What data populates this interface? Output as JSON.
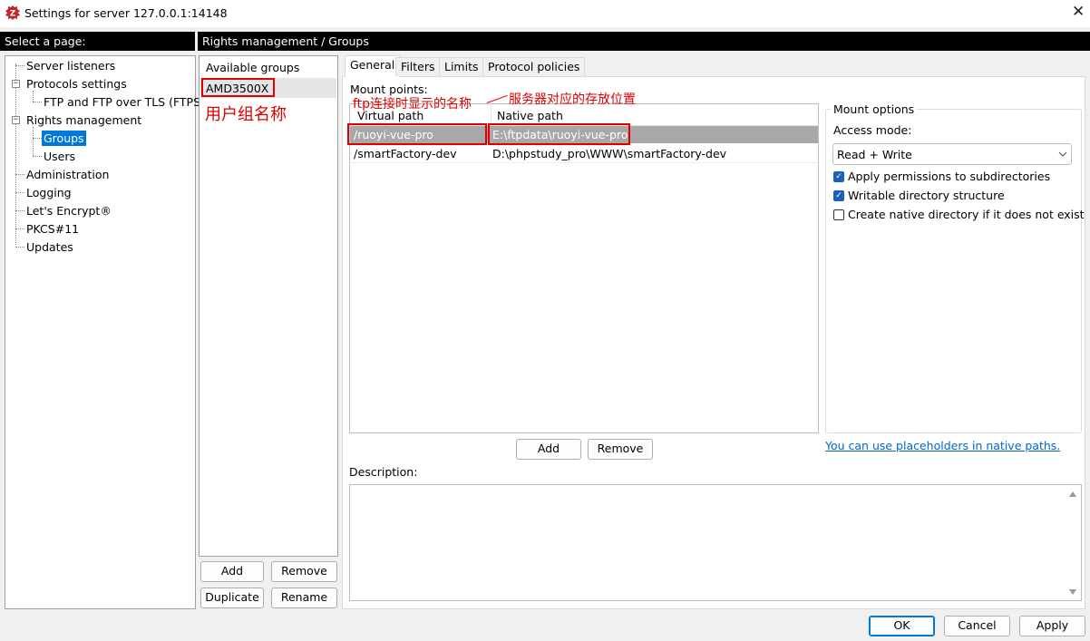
{
  "window": {
    "title": "Settings for server 127.0.0.1:14148",
    "close_glyph": "✕"
  },
  "left_header": "Select a page:",
  "tree": [
    {
      "label": "Server listeners"
    },
    {
      "label": "Protocols settings",
      "expander": "−"
    },
    {
      "label": "FTP and FTP over TLS (FTPS)"
    },
    {
      "label": "Rights management",
      "expander": "−"
    },
    {
      "label": "Groups",
      "selected": true
    },
    {
      "label": "Users"
    },
    {
      "label": "Administration"
    },
    {
      "label": "Logging"
    },
    {
      "label": "Let's Encrypt®"
    },
    {
      "label": "PKCS#11"
    },
    {
      "label": "Updates"
    }
  ],
  "right_header": "Rights management / Groups",
  "groups": {
    "title": "Available groups",
    "items": [
      "AMD3500X"
    ],
    "add_label": "Add",
    "remove_label": "Remove",
    "duplicate_label": "Duplicate",
    "rename_label": "Rename"
  },
  "tabs": [
    "General",
    "Filters",
    "Limits",
    "Protocol policies"
  ],
  "active_tab": "General",
  "mount_points": {
    "label": "Mount points:",
    "columns": [
      "Virtual path",
      "Native path"
    ],
    "rows": [
      {
        "virtual": "/ruoyi-vue-pro",
        "native": "E:\\ftpdata\\ruoyi-vue-pro",
        "selected": true
      },
      {
        "virtual": "/smartFactory-dev",
        "native": "D:\\phpstudy_pro\\WWW\\smartFactory-dev"
      }
    ],
    "add_label": "Add",
    "remove_label": "Remove"
  },
  "mount_options": {
    "title": "Mount options",
    "access_mode_label": "Access mode:",
    "access_mode_value": "Read + Write",
    "checkboxes": [
      {
        "label": "Apply permissions to subdirectories",
        "checked": true
      },
      {
        "label": "Writable directory structure",
        "checked": true
      },
      {
        "label": "Create native directory if it does not exist",
        "checked": false
      }
    ],
    "placeholder_link": "You can use placeholders in native paths."
  },
  "description_label": "Description:",
  "annotations": {
    "group_name": "用户组名称",
    "virtual_path": "ftp连接时显示的名称",
    "native_path": "服务器对应的存放位置"
  },
  "footer": {
    "ok_label": "OK",
    "cancel_label": "Cancel",
    "apply_label": "Apply"
  },
  "colors": {
    "selection": "#0078d7",
    "row_selected": "#a8a8a8",
    "annotation": "#e00000",
    "link": "#0066cc",
    "header_bg": "#000000"
  }
}
